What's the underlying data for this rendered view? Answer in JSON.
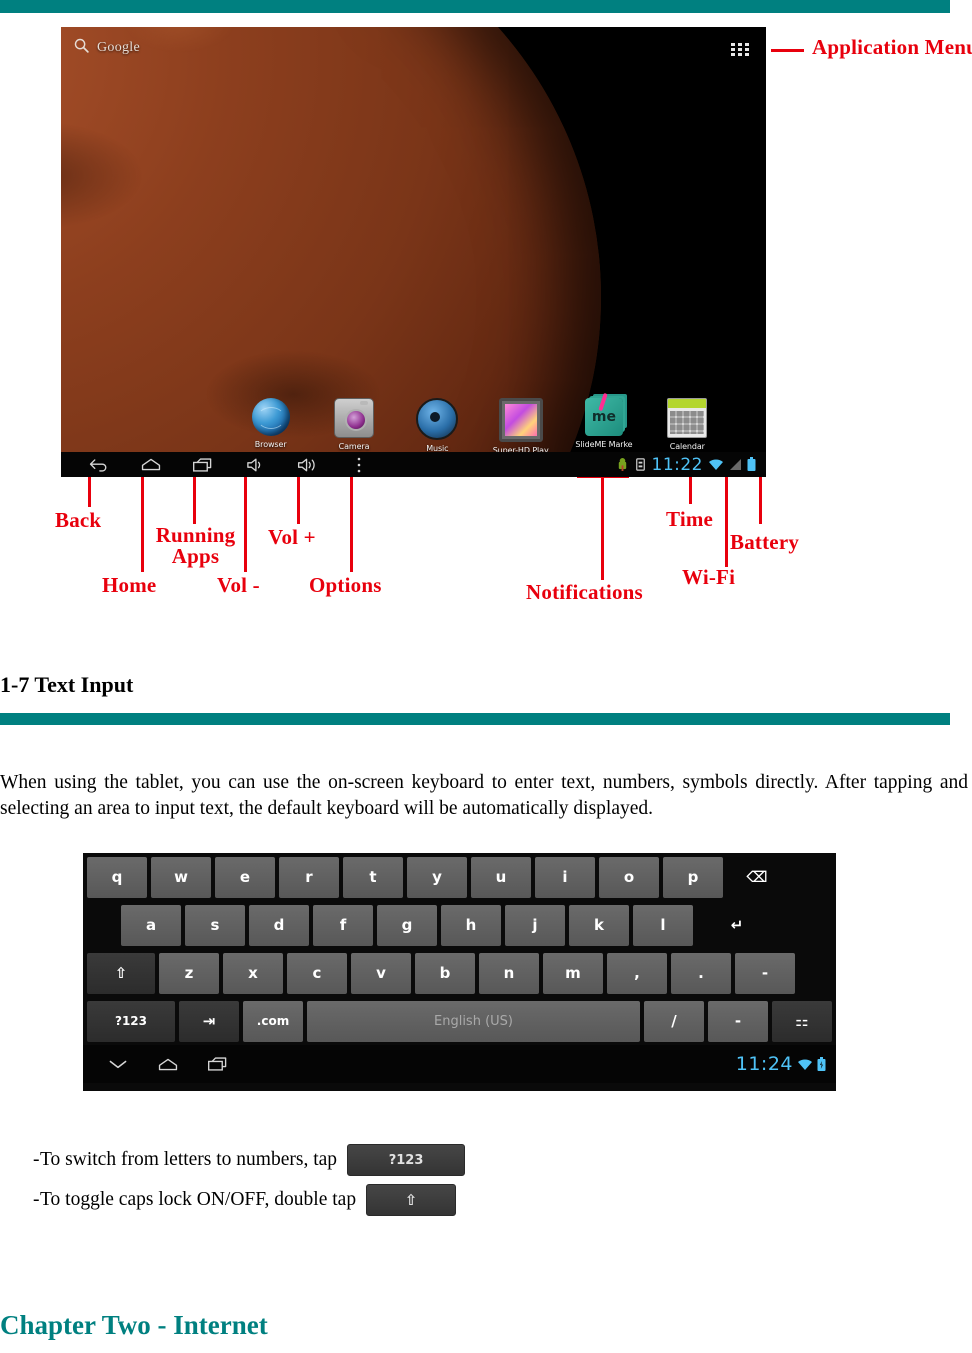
{
  "document": {
    "section_heading": "1-7 Text Input",
    "paragraph": "When using the tablet, you can use the on-screen keyboard to enter text, numbers, symbols directly. After tapping and selecting an area to input text, the default keyboard will be automatically displayed.",
    "chapter_heading": "Chapter Two - Internet",
    "accent_color": "#008080",
    "annotation_color": "#e8000d"
  },
  "tablet_screenshot": {
    "search_widget": {
      "label": "Google",
      "icon": "search-icon"
    },
    "app_menu": {
      "icon": "apps-grid-icon"
    },
    "apps": [
      {
        "label": "Browser",
        "icon": "browser-globe-icon"
      },
      {
        "label": "Camera",
        "icon": "camera-icon"
      },
      {
        "label": "Music",
        "icon": "music-speaker-icon"
      },
      {
        "label": "Super-HD Play",
        "icon": "video-player-icon"
      },
      {
        "label": "SlideME Marke",
        "icon": "slideme-market-icon"
      },
      {
        "label": "Calendar",
        "icon": "calendar-icon"
      }
    ],
    "nav_buttons": [
      {
        "name": "back",
        "icon": "back-arrow-icon"
      },
      {
        "name": "home",
        "icon": "home-icon"
      },
      {
        "name": "recents",
        "icon": "recent-apps-icon"
      },
      {
        "name": "volume-down",
        "icon": "volume-down-icon"
      },
      {
        "name": "volume-up",
        "icon": "volume-up-icon"
      },
      {
        "name": "options",
        "icon": "overflow-menu-icon"
      }
    ],
    "status_bar": {
      "time": "11:22",
      "notification_icons": [
        "android-robot-icon",
        "usb-debug-icon"
      ],
      "wifi_icon": "wifi-icon",
      "signal_icon": "signal-bars-icon",
      "battery_icon": "battery-icon"
    }
  },
  "annotations": [
    {
      "label": "Application Menu",
      "target": "app-menu"
    },
    {
      "label": "Back",
      "target": "back-button"
    },
    {
      "label": "Home",
      "target": "home-button"
    },
    {
      "label": "Running Apps",
      "target": "recents-button"
    },
    {
      "label": "Vol -",
      "target": "volume-down-button"
    },
    {
      "label": "Vol +",
      "target": "volume-up-button"
    },
    {
      "label": "Options",
      "target": "options-button"
    },
    {
      "label": "Notifications",
      "target": "notification-icons"
    },
    {
      "label": "Time",
      "target": "status-clock"
    },
    {
      "label": "Wi-Fi",
      "target": "wifi-icon"
    },
    {
      "label": "Battery",
      "target": "battery-icon"
    }
  ],
  "keyboard_screenshot": {
    "rows": [
      [
        {
          "label": "q",
          "style": "key"
        },
        {
          "label": "w",
          "style": "key"
        },
        {
          "label": "e",
          "style": "key"
        },
        {
          "label": "r",
          "style": "key"
        },
        {
          "label": "t",
          "style": "key"
        },
        {
          "label": "y",
          "style": "key"
        },
        {
          "label": "u",
          "style": "key"
        },
        {
          "label": "i",
          "style": "key"
        },
        {
          "label": "o",
          "style": "key"
        },
        {
          "label": "p",
          "style": "key"
        },
        {
          "label": "⌫",
          "style": "plain",
          "name": "backspace-key"
        }
      ],
      [
        {
          "label": "a",
          "style": "key"
        },
        {
          "label": "s",
          "style": "key"
        },
        {
          "label": "d",
          "style": "key"
        },
        {
          "label": "f",
          "style": "key"
        },
        {
          "label": "g",
          "style": "key"
        },
        {
          "label": "h",
          "style": "key"
        },
        {
          "label": "j",
          "style": "key"
        },
        {
          "label": "k",
          "style": "key"
        },
        {
          "label": "l",
          "style": "key"
        },
        {
          "label": "↵",
          "style": "plain",
          "name": "enter-key"
        }
      ],
      [
        {
          "label": "⇧",
          "style": "dark",
          "name": "shift-key"
        },
        {
          "label": "z",
          "style": "key"
        },
        {
          "label": "x",
          "style": "key"
        },
        {
          "label": "c",
          "style": "key"
        },
        {
          "label": "v",
          "style": "key"
        },
        {
          "label": "b",
          "style": "key"
        },
        {
          "label": "n",
          "style": "key"
        },
        {
          "label": "m",
          "style": "key"
        },
        {
          "label": ",",
          "style": "key"
        },
        {
          "label": ".",
          "style": "key"
        },
        {
          "label": "-",
          "style": "key"
        }
      ],
      [
        {
          "label": "?123",
          "style": "dark",
          "name": "symbols-key"
        },
        {
          "label": "⇥",
          "style": "dark",
          "name": "tab-key"
        },
        {
          "label": ".com",
          "style": "key",
          "name": "dotcom-key"
        },
        {
          "label": "English (US)",
          "style": "space",
          "name": "spacebar"
        },
        {
          "label": "/",
          "style": "key"
        },
        {
          "label": "-",
          "style": "key"
        },
        {
          "label": "⚏",
          "style": "dark",
          "name": "keyboard-settings-key"
        }
      ]
    ],
    "navbar": {
      "buttons": [
        {
          "name": "hide-keyboard",
          "icon": "chevron-down-icon"
        },
        {
          "name": "home",
          "icon": "home-icon"
        },
        {
          "name": "recents",
          "icon": "recent-apps-icon"
        }
      ],
      "time": "11:24",
      "wifi_icon": "wifi-icon",
      "battery_icon": "battery-charging-icon"
    }
  },
  "instructions": [
    {
      "dash": "-",
      "text": "To switch from letters to numbers, tap",
      "key_label": "?123"
    },
    {
      "dash": "-",
      "text": "To toggle caps lock ON/OFF, double tap",
      "key_label": "⇧"
    }
  ]
}
